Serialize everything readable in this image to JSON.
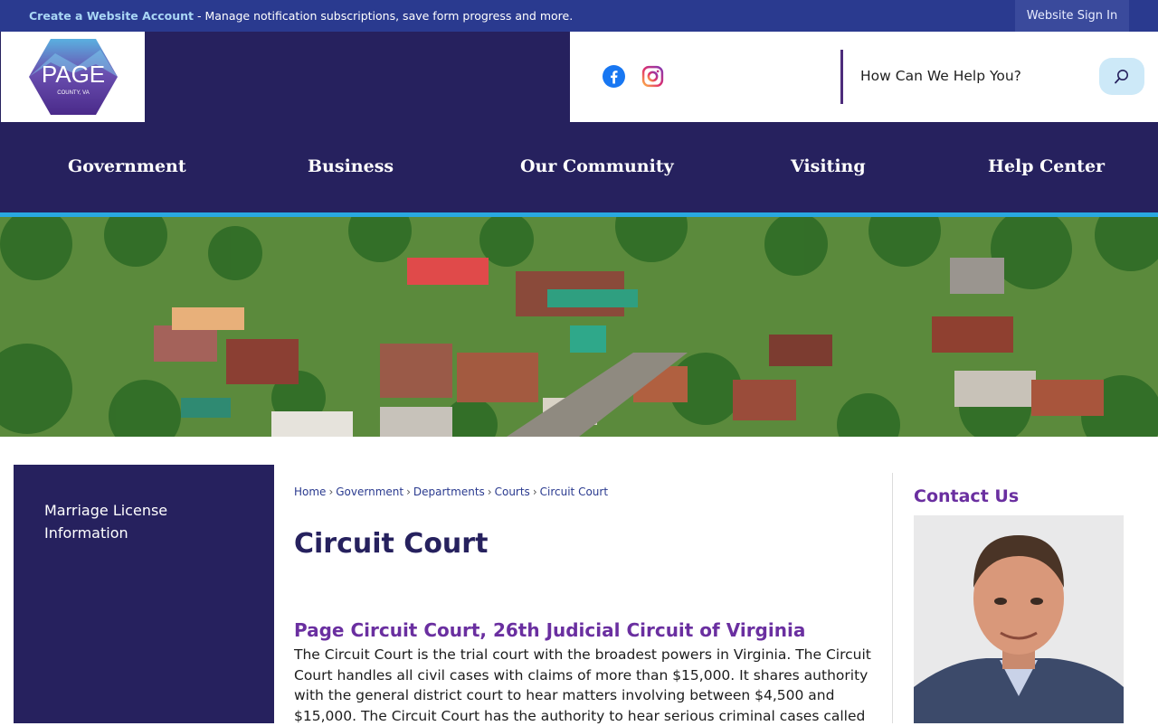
{
  "topbar": {
    "create_account": "Create a Website Account",
    "message": " - Manage notification subscriptions, save form progress and more.",
    "sign_in": "Website Sign In"
  },
  "logo": {
    "name": "PAGE",
    "sub": "COUNTY, VA"
  },
  "social": {
    "facebook_icon": "facebook-icon",
    "instagram_icon": "instagram-icon"
  },
  "search": {
    "label": "How Can We Help You?",
    "icon": "search-icon"
  },
  "nav": {
    "items": [
      {
        "label": "Government"
      },
      {
        "label": "Business"
      },
      {
        "label": "Our Community"
      },
      {
        "label": "Visiting"
      },
      {
        "label": "Help Center"
      }
    ]
  },
  "sidebar": {
    "items": [
      {
        "label": "Marriage License Information"
      }
    ]
  },
  "breadcrumb": {
    "items": [
      "Home",
      "Government",
      "Departments",
      "Courts",
      "Circuit Court"
    ]
  },
  "main": {
    "title": "Circuit Court",
    "subtitle": "Page Circuit Court, 26th Judicial Circuit of Virginia",
    "body": "The Circuit Court is the trial court with the broadest powers in Virginia. The Circuit Court handles all civil cases with claims of more than $15,000. It shares authority with the general district court to hear matters involving between $4,500 and $15,000. The Circuit Court has the authority to hear serious criminal cases called"
  },
  "contact": {
    "title": "Contact Us"
  },
  "colors": {
    "navy": "#26215e",
    "topbar": "#2a3a8f",
    "accent": "#29a8e0",
    "purple": "#6a2fa0"
  }
}
